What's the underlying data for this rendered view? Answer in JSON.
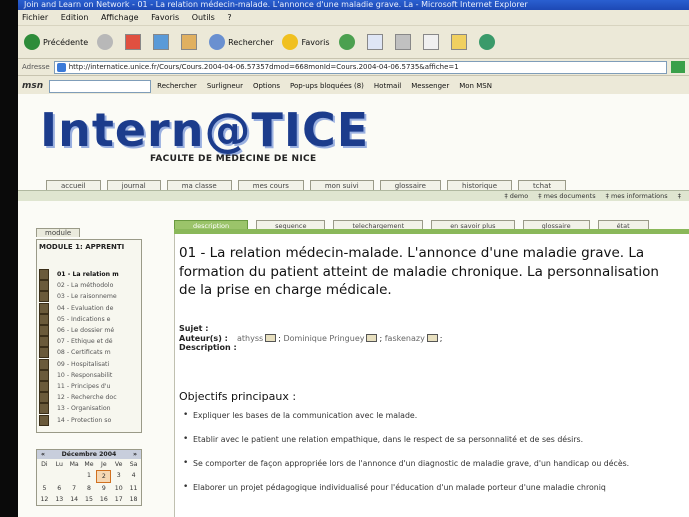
{
  "browser": {
    "title": "Join and Learn on Network - 01 - La relation médecin-malade. L'annonce d'une maladie grave. La - Microsoft Internet Explorer",
    "menu": [
      "Fichier",
      "Edition",
      "Affichage",
      "Favoris",
      "Outils",
      "?"
    ],
    "toolbar": {
      "back": "Précédente",
      "search": "Rechercher",
      "favorites": "Favoris"
    },
    "address_label": "Adresse",
    "address": "http://internatice.unice.fr/Cours/Cours.2004-04-06.57357dmod=668monId=Cours.2004-04-06.5735&affiche=1",
    "msn": {
      "logo": "msn",
      "search_btn": "Rechercher",
      "highlight": "Surligneur",
      "options": "Options",
      "popups": "Pop-ups bloquées (8)",
      "hotmail": "Hotmail",
      "messenger": "Messenger",
      "mymsn": "Mon MSN"
    }
  },
  "site": {
    "logo": "Intern@TICE",
    "subtitle": "FACULTE DE MEDECINE DE NICE",
    "nav": [
      "accueil",
      "journal",
      "ma classe",
      "mes cours",
      "mon suivi",
      "glossaire",
      "historique",
      "tchat"
    ],
    "subnav": [
      "‡ demo",
      "‡ mes documents",
      "‡ mes informations",
      "‡"
    ]
  },
  "sidebar": {
    "tab": "module",
    "title": "MODULE 1: APPRENTI",
    "items": [
      "01 - La relation m",
      "02 - La méthodolo",
      "03 - Le raisonneme",
      "04 - Evaluation de",
      "05 - Indications e",
      "06 - Le dossier mé",
      "07 - Ethique et dé",
      "08 - Certificats m",
      "09 - Hospitalisati",
      "10 - Responsabilit",
      "11 - Principes d'u",
      "12 - Recherche doc",
      "13 - Organisation",
      "14 - Protection so"
    ],
    "calendar": {
      "prev": "«",
      "month": "Décembre 2004",
      "next": "»",
      "days": [
        "Di",
        "Lu",
        "Ma",
        "Me",
        "Je",
        "Ve",
        "Sa"
      ],
      "row1": [
        "",
        "",
        "",
        "1",
        "2",
        "3",
        "4"
      ],
      "row2": [
        "5",
        "6",
        "7",
        "8",
        "9",
        "10",
        "11"
      ],
      "row3": [
        "12",
        "13",
        "14",
        "15",
        "16",
        "17",
        "18"
      ]
    }
  },
  "tabs": [
    "description",
    "sequence",
    "telechargement",
    "en savoir plus",
    "glossaire",
    "état"
  ],
  "course": {
    "title": "01 - La relation médecin-malade. L'annonce d'une maladie grave. La formation du patient atteint de maladie chronique. La personnalisation de la prise en charge médicale.",
    "subject_label": "Sujet :",
    "authors_label": "Auteur(s) :",
    "authors": [
      "athyss",
      "Dominique Pringuey",
      "faskenazy"
    ],
    "description_label": "Description :",
    "objectives_title": "Objectifs principaux :",
    "objectives": [
      "Expliquer les bases de la communication avec le malade.",
      "Etablir avec le patient une relation empathique, dans le respect de sa personnalité et de ses désirs.",
      "Se comporter de façon appropriée lors de l'annonce d'un diagnostic de maladie grave, d'un handicap ou décès.",
      "Elaborer un projet pédagogique individualisé pour l'éducation d'un malade porteur d'une maladie chroniq"
    ]
  },
  "colors": {
    "title_bar": "#1d49b5",
    "logo": "#1c3c8c",
    "active_tab": "#9bc46a"
  }
}
